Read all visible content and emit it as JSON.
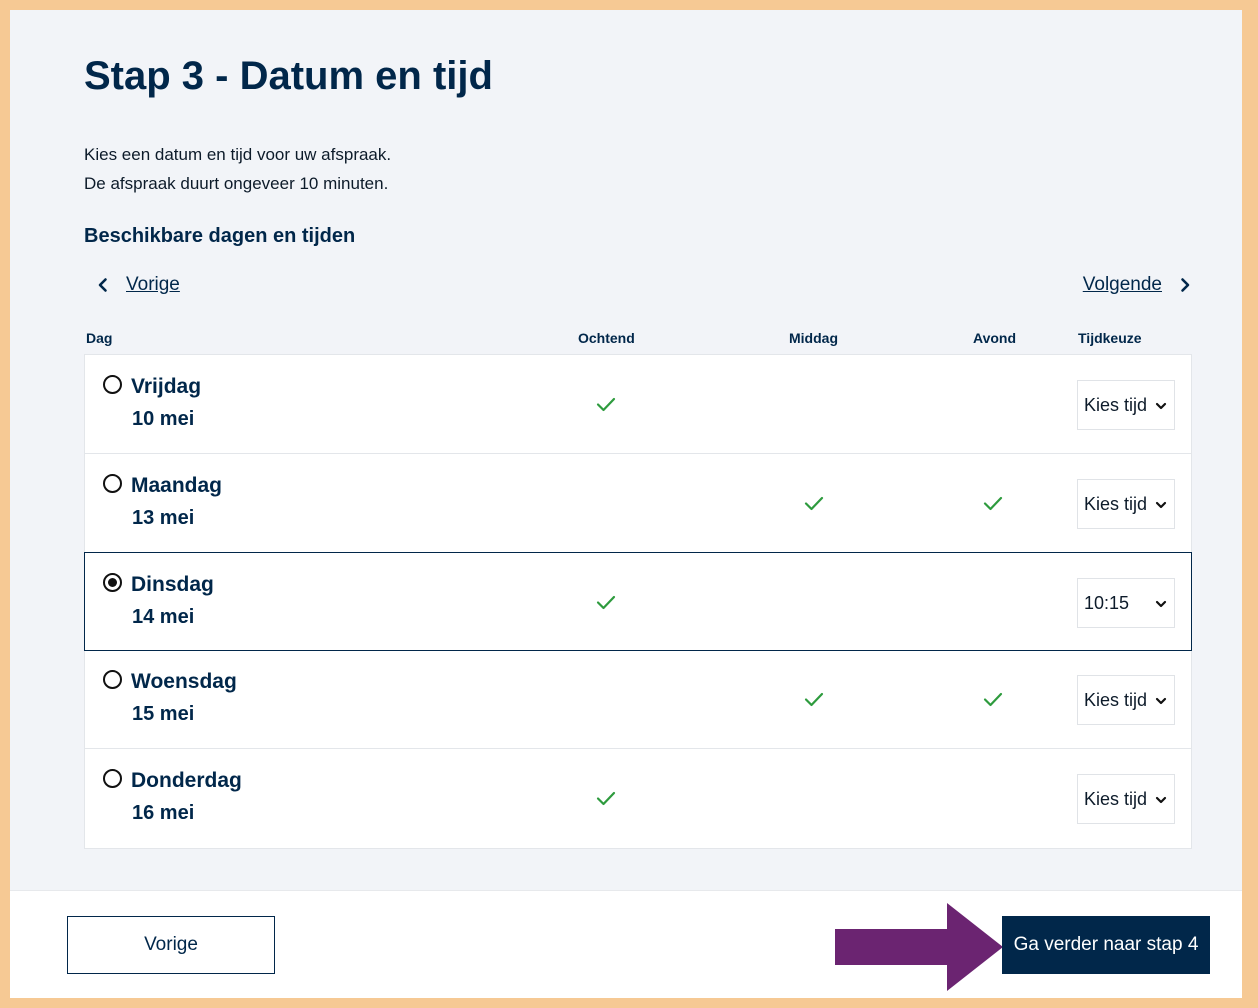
{
  "title": "Stap 3 - Datum en tijd",
  "intro": {
    "line1": "Kies een datum en tijd voor uw afspraak.",
    "line2": "De afspraak duurt ongeveer 10 minuten."
  },
  "section_title": "Beschikbare dagen en tijden",
  "nav": {
    "prev": "Vorige",
    "next": "Volgende"
  },
  "columns": {
    "day": "Dag",
    "morning": "Ochtend",
    "afternoon": "Middag",
    "evening": "Avond",
    "time": "Tijdkeuze"
  },
  "rows": [
    {
      "day": "Vrijdag",
      "date": "10 mei",
      "morning": true,
      "afternoon": false,
      "evening": false,
      "time": "Kies tijd",
      "selected": false
    },
    {
      "day": "Maandag",
      "date": "13 mei",
      "morning": false,
      "afternoon": true,
      "evening": true,
      "time": "Kies tijd",
      "selected": false
    },
    {
      "day": "Dinsdag",
      "date": "14 mei",
      "morning": true,
      "afternoon": false,
      "evening": false,
      "time": "10:15",
      "selected": true
    },
    {
      "day": "Woensdag",
      "date": "15 mei",
      "morning": false,
      "afternoon": true,
      "evening": true,
      "time": "Kies tijd",
      "selected": false
    },
    {
      "day": "Donderdag",
      "date": "16 mei",
      "morning": true,
      "afternoon": false,
      "evening": false,
      "time": "Kies tijd",
      "selected": false
    }
  ],
  "footer": {
    "prev_button": "Vorige",
    "next_button": "Ga verder naar stap 4"
  },
  "colors": {
    "navy": "#01274a",
    "check": "#2e9b3e",
    "frame": "#f6c994",
    "arrow": "#6b2471"
  },
  "icons": {
    "nav_prev": "chevron-left-icon",
    "nav_next": "chevron-right-icon",
    "available": "check-icon",
    "select_caret": "chevron-down-icon",
    "annotation": "arrow-right-icon"
  }
}
